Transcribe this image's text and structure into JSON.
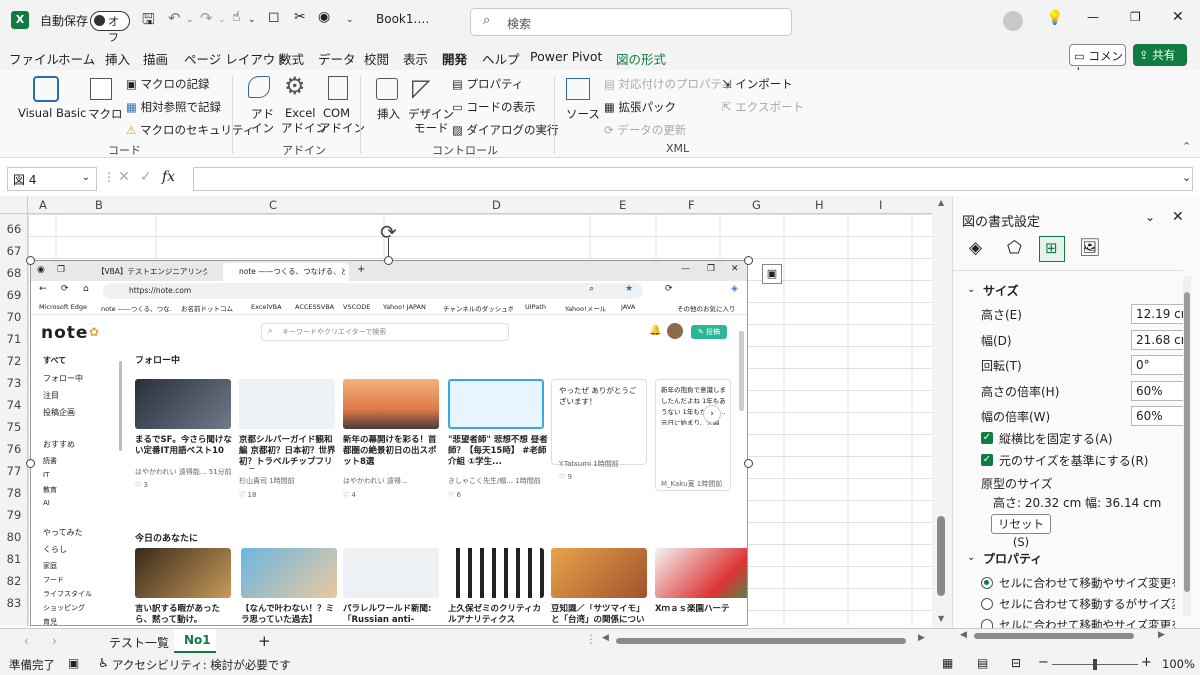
{
  "titlebar": {
    "autosave_label": "自動保存",
    "autosave_state": "オフ",
    "filename": "Book1.…",
    "search_placeholder": "検索"
  },
  "menu": {
    "items": [
      "ファイル",
      "ホーム",
      "挿入",
      "描画",
      "ページ レイアウト",
      "数式",
      "データ",
      "校閲",
      "表示",
      "開発",
      "ヘルプ",
      "Power Pivot",
      "図の形式"
    ],
    "active_index": 9,
    "comment": "コメント",
    "share": "共有"
  },
  "ribbon": {
    "visual_basic": "Visual Basic",
    "macro": "マクロ",
    "record_macro": "マクロの記録",
    "relative_ref": "相対参照で記録",
    "macro_security": "マクロのセキュリティ",
    "group_code": "コード",
    "addin": "アド",
    "addin2": "イン",
    "excel_addin": "Excel",
    "excel_addin2": "アドイン",
    "com_addin": "COM",
    "com_addin2": "アドイン",
    "group_addin": "アドイン",
    "insert": "挿入",
    "design_mode": "デザイン",
    "design_mode2": "モード",
    "properties": "プロパティ",
    "view_code": "コードの表示",
    "run_dialog": "ダイアログの実行",
    "group_controls": "コントロール",
    "source": "ソース",
    "map_props": "対応付けのプロパティ",
    "expansion_packs": "拡張パック",
    "refresh_data": "データの更新",
    "import": "インポート",
    "export": "エクスポート",
    "group_xml": "XML"
  },
  "formula": {
    "namebox": "図 4",
    "fx": "fx"
  },
  "grid": {
    "columns": [
      "A",
      "B",
      "C",
      "D",
      "E",
      "F",
      "G",
      "H",
      "I"
    ],
    "rows": [
      "66",
      "67",
      "68",
      "69",
      "70",
      "71",
      "72",
      "73",
      "74",
      "75",
      "76",
      "77",
      "78",
      "79",
      "80",
      "81",
      "82",
      "83"
    ]
  },
  "browser": {
    "tab1": "【VBA】テストエンジニアリング】Eビ",
    "tab2": "note ——つくる、つなげる、とどける。",
    "url": "https://note.com",
    "bookmarks": [
      "Microsoft Edge",
      "note ——つくる、つな...",
      "お名前ドットコム",
      "ExcelVBA",
      "ACCESSVBA",
      "VSCODE",
      "Yahoo! JAPAN",
      "チャンネルのダッシュボ...",
      "UIPath",
      "Yahoo!メール",
      "JAVA",
      "その他のお気に入り"
    ],
    "logo": "note",
    "search_placeholder": "キーワードやクリエイターで検索",
    "post_btn": "投稿",
    "sidebar": [
      "すべて",
      "フォロー中",
      "注目",
      "投稿企画",
      "おすすめ",
      "読書",
      "IT",
      "教育",
      "AI",
      "やってみた",
      "くらし",
      "家庭",
      "フード",
      "ライフスタイル",
      "ショッピング",
      "育児"
    ],
    "section_follow": "フォロー中",
    "section_today": "今日のあなたに",
    "follow_cards": [
      {
        "title": "まるでSF。今さら聞けない定番IT用語ベスト10",
        "meta": "はやかわれい 遠得能... 51分前",
        "likes": "3"
      },
      {
        "title": "京都シルバーガイド観和編 京都初？日本初？世界初？トラベルチップフリーラ...",
        "meta": "杉山貴司 1時間前",
        "likes": "18"
      },
      {
        "title": "新年の幕開けを彩る！首都圏の絶景初日の出スポット8選",
        "meta": "はやかわれい 遠得...",
        "likes": "4"
      },
      {
        "title": "\"悲望者師\" 悲想不想 昼者師？【毎天15時】 #老師 介組 ①学生...",
        "meta": "きしゃこく先生/帽... 1時間前",
        "likes": "6"
      },
      {
        "title": "やったぜ ありがとうございます！",
        "meta": "Y.Tatsumi 1時間前",
        "likes": "9"
      },
      {
        "title": "新年の抱負で意識しましたんだよね 1年もあうない 1年もかから... 元日に始まり、大晦日...",
        "meta": "M_Kaku寛 1時間前",
        "likes": ""
      }
    ],
    "today_cards": [
      {
        "title": "言い訳する暇があったら、黙って動け。"
      },
      {
        "title": "【なんで叶わない！？ミラ思っていた過去】"
      },
      {
        "title": "パラレルワールド新聞: 「Russian anti-aircraft"
      },
      {
        "title": "上久保ゼミのクリティカルアナリティクス（CA）："
      },
      {
        "title": "豆知識／「サツマイモ」と「台湾」の関係について"
      },
      {
        "title": "Xｍａｓ楽園ハーテ"
      }
    ]
  },
  "sheets": {
    "tabs": [
      "テスト一覧",
      "No1"
    ],
    "active_index": 1
  },
  "status": {
    "ready": "準備完了",
    "accessibility": "アクセシビリティ: 検討が必要です",
    "zoom": "100%"
  },
  "pane": {
    "title": "図の書式設定",
    "size_section": "サイズ",
    "height_label": "高さ(E)",
    "height_value": "12.19 cm",
    "width_label": "幅(D)",
    "width_value": "21.68 cm",
    "rotation_label": "回転(T)",
    "rotation_value": "0°",
    "scale_h_label": "高さの倍率(H)",
    "scale_h_value": "60%",
    "scale_w_label": "幅の倍率(W)",
    "scale_w_value": "60%",
    "lock_aspect": "縦横比を固定する(A)",
    "relative_original": "元のサイズを基準にする(R)",
    "original_size": "原型のサイズ",
    "original_h": "高さ:  20.32 cm",
    "original_w": "幅:   36.14 cm",
    "reset": "リセット(S)",
    "props_section": "プロパティ",
    "radio1": "セルに合わせて移動やサイズ変更をする(S)",
    "radio2": "セルに合わせて移動するがサイズ変更はしな",
    "radio3": "セルに合わせて移動やサイズ変更をしない"
  },
  "colors": {
    "accent": "#107c41",
    "note_green": "#2cb696"
  }
}
